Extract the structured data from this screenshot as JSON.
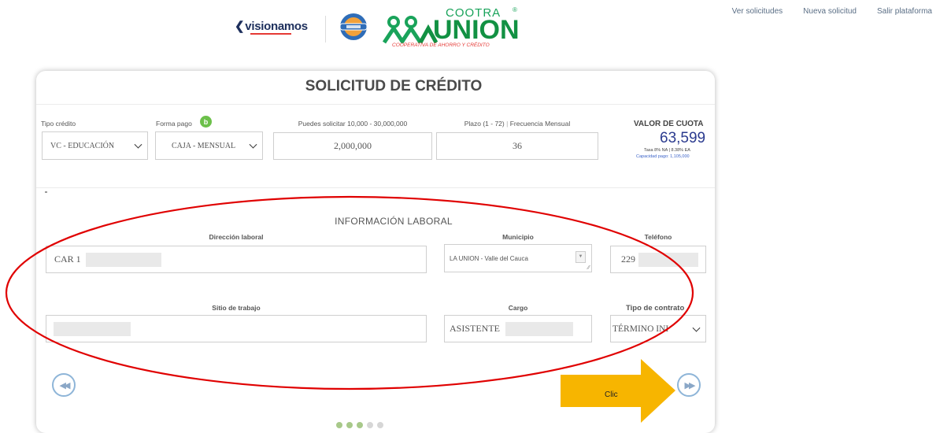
{
  "nav": {
    "links": [
      "Ver solicitudes",
      "Nueva solicitud",
      "Salir plataforma"
    ]
  },
  "header": {
    "visionamos_text": "visionamos",
    "coop_top": "COOTRA",
    "coop_reg": "®",
    "coop_main": "UNION",
    "coop_sub": "COOPERATIVA DE AHORRO Y CRÉDITO"
  },
  "form": {
    "title": "SOLICITUD DE CRÉDITO",
    "tipo_credito_label": "Tipo crédito",
    "tipo_credito_value": "VC - EDUCACIÓN",
    "forma_pago_label": "Forma pago",
    "forma_pago_badge": "b",
    "forma_pago_value": "CAJA - MENSUAL",
    "monto_label": "Puedes solicitar 10,000 - 30,000,000",
    "monto_value": "2,000,000",
    "plazo_label": "Plazo (1 - 72)",
    "frecuencia_label": "Frecuencia Mensual",
    "plazo_value": "36",
    "cuota_label": "VALOR DE CUOTA",
    "cuota_value": "63,599",
    "tasa_text": "Tasa 8% NA  |  8.38% EA",
    "capacidad_text": "Capacidad pago: 1,105,000"
  },
  "laboral": {
    "section_title": "INFORMACIÓN LABORAL",
    "direccion_label": "Dirección laboral",
    "direccion_value": "CAR 1",
    "municipio_label": "Municipio",
    "municipio_value": "LA UNION  - Valle del Cauca",
    "telefono_label": "Teléfono",
    "telefono_value": "229",
    "sitio_label": "Sitio de trabajo",
    "cargo_label": "Cargo",
    "cargo_value": "ASISTENTE",
    "contrato_label": "Tipo de contrato",
    "contrato_value": "TÉRMINO INI"
  },
  "pager": {
    "prev_symbol": "◀◀",
    "next_symbol": "▶▶",
    "steps": 5,
    "current_step": 3
  },
  "annotation": {
    "clic_label": "Clic",
    "ellipse_color": "#e00000",
    "arrow_color": "#f7b500"
  }
}
